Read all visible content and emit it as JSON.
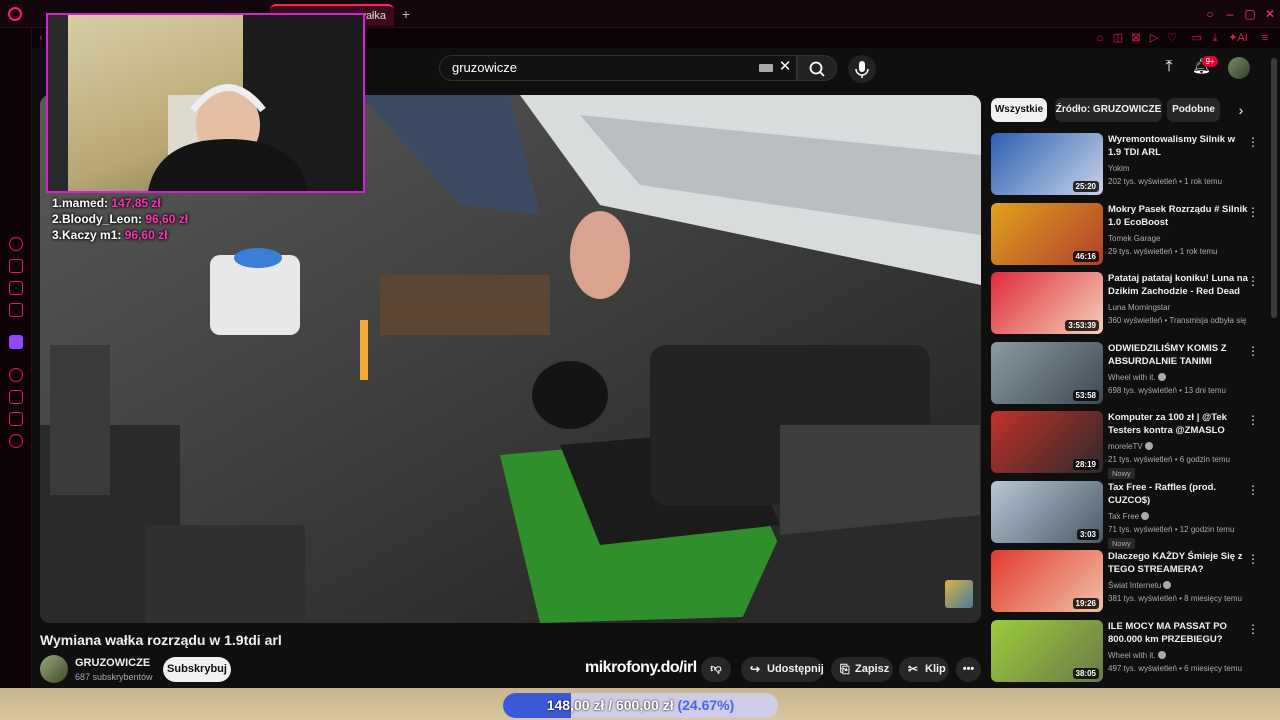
{
  "browser": {
    "active_tab_fragment": "wałka",
    "new_tab_symbol": "+"
  },
  "search": {
    "query": "gruzowicze"
  },
  "header": {
    "notification_badge": "9+"
  },
  "overlay": {
    "leaderboard": [
      {
        "rank": "1.",
        "name": "mamed:",
        "amount": "147,85 zł"
      },
      {
        "rank": "2.",
        "name": "Bloody_Leon:",
        "amount": "96,60 zł"
      },
      {
        "rank": "3.",
        "name": "Kaczy m1:",
        "amount": "96,60 zł"
      }
    ],
    "watermark": "mikrofony.do/irl",
    "donation": {
      "current": "148,00 zł",
      "separator": "/",
      "goal": "600,00 zł",
      "percent_label": "(24.67%)",
      "progress": 0.2467
    }
  },
  "video": {
    "title": "Wymiana wałka rozrządu w 1.9tdi arl",
    "channel": "GRUZOWICZE",
    "subscribers": "687 subskrybentów",
    "subscribe_label": "Subskrybuj",
    "share_label": "Udostępnij",
    "save_label": "Zapisz",
    "clip_label": "Klip"
  },
  "chips": {
    "all": "Wszystkie",
    "source": "Źródło: GRUZOWICZE",
    "similar": "Podobne"
  },
  "recommendations": [
    {
      "title": "Wyremontowalismy Silnik w 1.9 TDI ARL",
      "channel": "Yokim",
      "meta": "202 tys. wyświetleń • 1 rok temu",
      "duration": "25:20",
      "verified": false,
      "is_new": false,
      "colors": [
        "#2d5fb3",
        "#c9d3e6"
      ]
    },
    {
      "title": "Mokry Pasek Rozrządu # Silnik 1.0 EcoBoost",
      "channel": "Tomek Garage",
      "meta": "29 tys. wyświetleń • 1 rok temu",
      "duration": "46:16",
      "verified": false,
      "is_new": false,
      "colors": [
        "#e0a21c",
        "#b0402a"
      ]
    },
    {
      "title": "Patataj patataj koniku! Luna na Dzikim Zachodzie - Red Dead ...",
      "channel": "Luna Morningstar",
      "meta": "360 wyświetleń • Transmisja odbyła się ...",
      "duration": "3:53:39",
      "verified": false,
      "is_new": false,
      "colors": [
        "#e02a3a",
        "#f3d0b8"
      ]
    },
    {
      "title": "ODWIEDZILIŚMY KOMIS Z ABSURDALNIE TANIMI AUTAMI",
      "channel": "Wheel with it.",
      "meta": "698 tys. wyświetleń • 13 dni temu",
      "duration": "53:58",
      "verified": true,
      "is_new": false,
      "colors": [
        "#8c9aa3",
        "#3d4a55"
      ]
    },
    {
      "title": "Komputer za 100 zł | @Tek Testers kontra @ZMASLO",
      "channel": "moreleTV",
      "meta": "21 tys. wyświetleń • 6 godzin temu",
      "duration": "28:19",
      "verified": true,
      "is_new": true,
      "new_label": "Nowy",
      "colors": [
        "#c4302a",
        "#2a2a2a"
      ]
    },
    {
      "title": "Tax Free - Raffles (prod. CUZCO$)",
      "channel": "Tax Free",
      "meta": "71 tys. wyświetleń • 12 godzin temu",
      "duration": "3:03",
      "verified": true,
      "is_new": true,
      "new_label": "Nowy",
      "colors": [
        "#b7c7d6",
        "#4b5a66"
      ]
    },
    {
      "title": "Dlaczego KAŻDY Śmieje Się z TEGO STREAMERA?",
      "channel": "Świat Internetu",
      "meta": "381 tys. wyświetleń • 8 miesięcy temu",
      "duration": "19:26",
      "verified": true,
      "is_new": false,
      "colors": [
        "#e23a2f",
        "#f0c0a8"
      ]
    },
    {
      "title": "ILE MOCY MA PASSAT PO 800.000 km PRZEBIEGU?",
      "channel": "Wheel with it.",
      "meta": "497 tys. wyświetleń • 6 miesięcy temu",
      "duration": "38:05",
      "verified": true,
      "is_new": false,
      "colors": [
        "#9ccc3a",
        "#6b7a4a"
      ]
    }
  ],
  "icons": {
    "search": "search-icon",
    "mic": "mic-icon",
    "upload": "upload-icon",
    "bell": "bell-icon",
    "dislike": "thumbs-down-icon",
    "share": "share-icon",
    "save": "bookmark-icon",
    "clip": "scissors-icon",
    "more": "more-vert-icon"
  },
  "colors": {
    "accent": "#e21b54",
    "webcam_border": "#d61fd6",
    "donation_fill": "#3b59d6",
    "leaderboard_amount": "#ff2fb8"
  }
}
